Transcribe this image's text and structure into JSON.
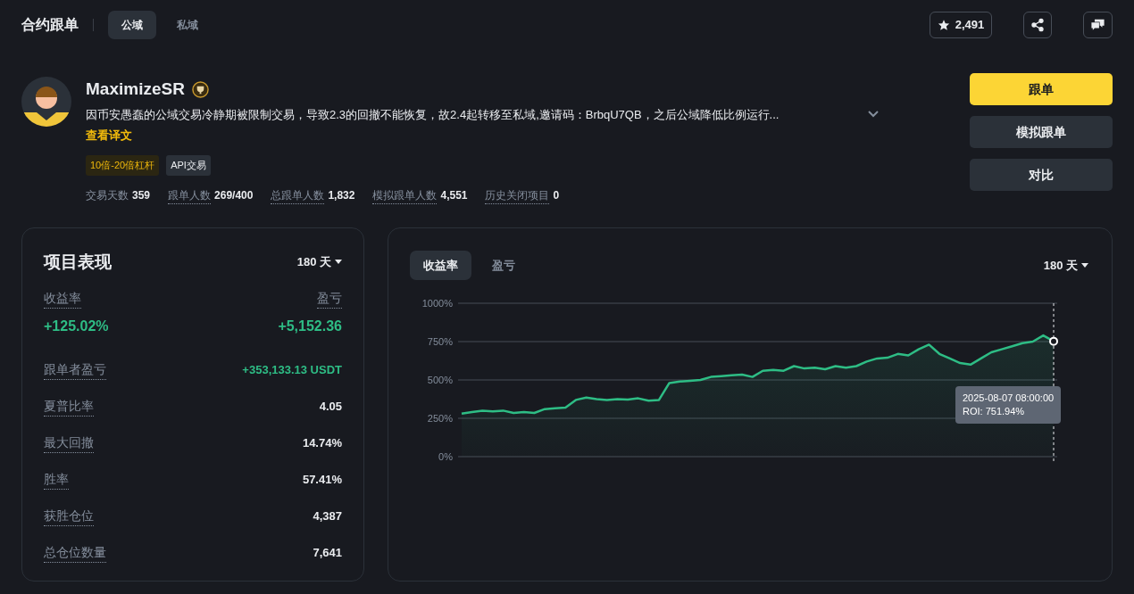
{
  "header": {
    "title": "合约跟单",
    "tabs": [
      {
        "label": "公域",
        "selected": true
      },
      {
        "label": "私域",
        "selected": false
      }
    ],
    "favorites": "2,491"
  },
  "profile": {
    "name": "MaximizeSR",
    "bio": "因币安愚蠢的公域交易冷静期被限制交易，导致2.3的回撤不能恢复，故2.4起转移至私域,邀请码：BrbqU7QB，之后公域降低比例运行...",
    "translate_link": "查看译文",
    "tags": [
      {
        "label": "10倍-20倍杠杆",
        "kind": "leverage"
      },
      {
        "label": "API交易",
        "kind": "plain"
      }
    ],
    "stats": [
      {
        "label": "交易天数",
        "value": "359",
        "underlined": false
      },
      {
        "label": "跟单人数",
        "value": "269/400",
        "underlined": true
      },
      {
        "label": "总跟单人数",
        "value": "1,832",
        "underlined": true
      },
      {
        "label": "模拟跟单人数",
        "value": "4,551",
        "underlined": true
      },
      {
        "label": "历史关闭项目",
        "value": "0",
        "underlined": true
      }
    ]
  },
  "actions": [
    {
      "label": "跟单",
      "kind": "primary"
    },
    {
      "label": "模拟跟单",
      "kind": "secondary"
    },
    {
      "label": "对比",
      "kind": "secondary"
    }
  ],
  "performance": {
    "title": "项目表现",
    "period": "180 天",
    "summary": [
      {
        "label": "收益率",
        "value": "+125.02%"
      },
      {
        "label": "盈亏",
        "value": "+5,152.36"
      }
    ],
    "metrics": [
      {
        "label": "跟单者盈亏",
        "value": "+353,133.13 USDT",
        "kind": "gain"
      },
      {
        "label": "夏普比率",
        "value": "4.05",
        "kind": "plain"
      },
      {
        "label": "最大回撤",
        "value": "14.74%",
        "kind": "plain"
      },
      {
        "label": "胜率",
        "value": "57.41%",
        "kind": "plain"
      },
      {
        "label": "获胜仓位",
        "value": "4,387",
        "kind": "plain"
      },
      {
        "label": "总仓位数量",
        "value": "7,641",
        "kind": "plain"
      }
    ]
  },
  "chart_panel": {
    "tabs": [
      {
        "label": "收益率",
        "selected": true
      },
      {
        "label": "盈亏",
        "selected": false
      }
    ],
    "period": "180 天",
    "tooltip": {
      "date": "2025-08-07 08:00:00",
      "roi": "ROI: 751.94%"
    },
    "chart_data": {
      "type": "area",
      "ylim": [
        0,
        1000
      ],
      "yticks": [
        {
          "value": 0,
          "label": "0%"
        },
        {
          "value": 250,
          "label": "250%"
        },
        {
          "value": 500,
          "label": "500%"
        },
        {
          "value": 750,
          "label": "750%"
        },
        {
          "value": 1000,
          "label": "1000%"
        }
      ],
      "grid": true,
      "series": [
        {
          "color": "#2ebd85",
          "values": [
            280,
            290,
            300,
            295,
            300,
            285,
            290,
            285,
            310,
            315,
            320,
            370,
            385,
            375,
            370,
            375,
            372,
            380,
            365,
            370,
            480,
            490,
            495,
            500,
            520,
            525,
            530,
            535,
            520,
            560,
            565,
            560,
            590,
            575,
            580,
            570,
            590,
            580,
            590,
            620,
            640,
            645,
            670,
            660,
            700,
            730,
            670,
            640,
            610,
            600,
            640,
            680,
            700,
            720,
            740,
            750,
            790,
            752
          ]
        }
      ]
    }
  }
}
